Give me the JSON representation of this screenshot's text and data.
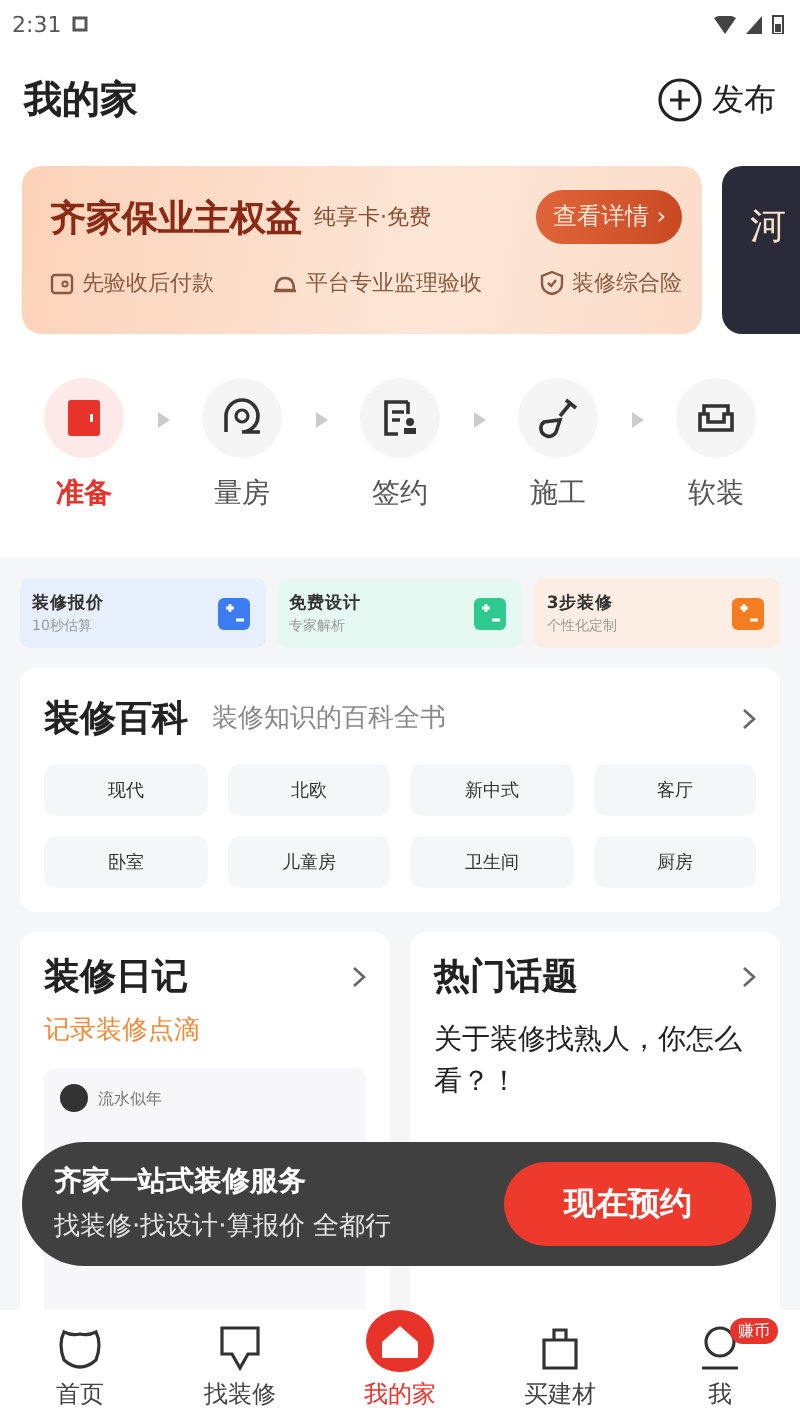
{
  "status_bar": {
    "time": "2:31"
  },
  "header": {
    "title": "我的家",
    "publish": "发布"
  },
  "banner": {
    "title": "齐家保业主权益",
    "subtitle": "纯享卡·免费",
    "button": "查看详情 ›",
    "features": [
      {
        "kind": "wallet",
        "label": "先验收后付款"
      },
      {
        "kind": "helmet",
        "label": "平台专业监理验收"
      },
      {
        "kind": "shield",
        "label": "装修综合险"
      }
    ]
  },
  "banner_next": {
    "title": "河"
  },
  "steps": [
    {
      "kind": "prepare",
      "label": "准备",
      "selected": true
    },
    {
      "kind": "measure",
      "label": "量房",
      "selected": false
    },
    {
      "kind": "contract",
      "label": "签约",
      "selected": false
    },
    {
      "kind": "build",
      "label": "施工",
      "selected": false
    },
    {
      "kind": "sofa",
      "label": "软装",
      "selected": false
    }
  ],
  "quick_cards": [
    {
      "kind": "quote",
      "title": "装修报价",
      "subtitle": "10秒估算",
      "color": "#3b7cf0"
    },
    {
      "kind": "design",
      "title": "免费设计",
      "subtitle": "专家解析",
      "color": "#2ec98f"
    },
    {
      "kind": "steps",
      "title": "3步装修",
      "subtitle": "个性化定制",
      "color": "#f57c1f"
    }
  ],
  "encyclopedia": {
    "title": "装修百科",
    "subtitle": "装修知识的百科全书",
    "tags": [
      "现代",
      "北欧",
      "新中式",
      "客厅",
      "卧室",
      "儿童房",
      "卫生间",
      "厨房"
    ]
  },
  "diary": {
    "title": "装修日记",
    "subtitle": "记录装修点滴",
    "author": "流水似年"
  },
  "topics": {
    "title": "热门话题",
    "question": "关于装修找熟人，你怎么看？！"
  },
  "promo": {
    "title": "齐家一站式装修服务",
    "subtitle": "找装修·找设计·算报价 全都行",
    "button": "现在预约"
  },
  "tabs": [
    {
      "kind": "home",
      "label": "首页",
      "selected": false
    },
    {
      "kind": "find",
      "label": "找装修",
      "selected": false
    },
    {
      "kind": "myhome",
      "label": "我的家",
      "selected": true
    },
    {
      "kind": "shop",
      "label": "买建材",
      "selected": false
    },
    {
      "kind": "me",
      "label": "我",
      "selected": false,
      "badge": "赚币"
    }
  ]
}
